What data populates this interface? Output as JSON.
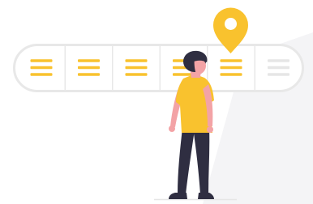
{
  "illustration": {
    "colors": {
      "accent": "#F9C22E",
      "pill_border": "#E8E8E8",
      "pill_fill": "#FFFFFF",
      "shadow": "#F4F4F6",
      "inactive_lines": "#E6E6E6",
      "skin": "#F3A3A6",
      "hair": "#2F2E41",
      "pants": "#2F2E41",
      "shoes": "#2F2E41",
      "shirt": "#F9C22E",
      "ground": "#E6E6E6"
    },
    "icons": {
      "pin": "location-pin-icon",
      "hamburger": "menu-lines-icon"
    },
    "step_bar": {
      "segment_states": [
        "active",
        "active",
        "active",
        "active",
        "active",
        "inactive"
      ],
      "pinned_segment_number": 5
    }
  }
}
